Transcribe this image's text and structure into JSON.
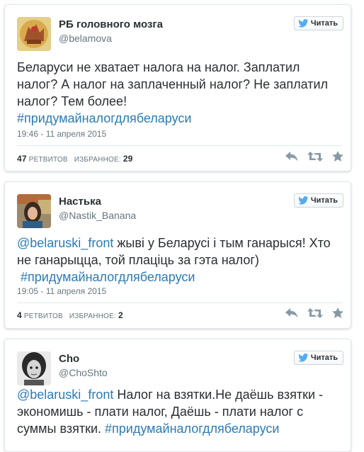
{
  "follow_label": "Читать",
  "tweets": [
    {
      "author_name": "РБ головного мозга",
      "handle": "@belamova",
      "text": "Беларуси не хватает налога на налог. Заплатил налог? А налог на заплаченный налог? Не заплатил налог? Тем более!",
      "hashtag": "#придумайналогдлябеларуси",
      "timestamp": "19:46 - 11 апреля 2015",
      "retweets_count": "47",
      "retweets_label": "РЕТВИТОВ",
      "favorites_label": "ИЗБРАННОЕ:",
      "favorites_count": "29"
    },
    {
      "author_name": "Настька",
      "handle": "@Nastik_Banana",
      "mention": "@belaruski_front",
      "text": " жыві у Беларусі і тым ганарыся! Хто не ганарыцца, той плаціць за гэта налог)",
      "hashtag": "#придумайналогдлябеларуси",
      "timestamp": "19:05 - 11 апреля 2015",
      "retweets_count": "4",
      "retweets_label": "РЕТВИТОВ",
      "favorites_label": "ИЗБРАННОЕ:",
      "favorites_count": "2"
    },
    {
      "author_name": "Cho",
      "handle": "@ChoShto",
      "mention": "@belaruski_front",
      "text": " Налог на взятки.Не даёшь взятки - экономишь - плати налог, Даёшь - плати налог с суммы взятки. ",
      "hashtag": "#придумайналогдлябеларуси"
    }
  ],
  "icons": {
    "bird": "twitter-bird-icon",
    "reply": "reply-icon",
    "retweet": "retweet-icon",
    "favorite": "star-icon"
  },
  "colors": {
    "link": "#2b7bb9",
    "bird": "#55acee",
    "action_icon": "#8899a6"
  }
}
